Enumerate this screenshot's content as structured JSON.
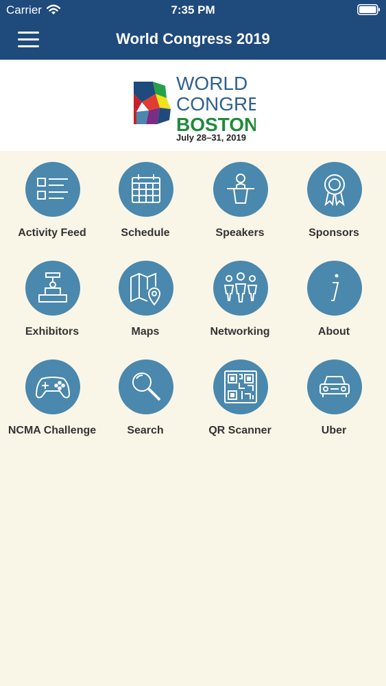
{
  "status_bar": {
    "carrier": "Carrier",
    "time": "7:35 PM"
  },
  "header": {
    "title": "World Congress 2019",
    "menu_icon": "hamburger-menu-icon"
  },
  "banner": {
    "logo_line1": "WORLD",
    "logo_line2": "CONGRESS",
    "logo_line3": "BOSTON",
    "dates": "July 28–31, 2019"
  },
  "tiles": [
    {
      "label": "Activity Feed",
      "icon": "activity-feed-icon"
    },
    {
      "label": "Schedule",
      "icon": "calendar-icon"
    },
    {
      "label": "Speakers",
      "icon": "speaker-podium-icon"
    },
    {
      "label": "Sponsors",
      "icon": "award-ribbon-icon"
    },
    {
      "label": "Exhibitors",
      "icon": "exhibitor-booth-icon"
    },
    {
      "label": "Maps",
      "icon": "map-pin-icon"
    },
    {
      "label": "Networking",
      "icon": "people-group-icon"
    },
    {
      "label": "About",
      "icon": "info-icon"
    },
    {
      "label": "NCMA Challenge",
      "icon": "gamepad-icon"
    },
    {
      "label": "Search",
      "icon": "magnifier-icon"
    },
    {
      "label": "QR Scanner",
      "icon": "qr-code-icon"
    },
    {
      "label": "Uber",
      "icon": "car-icon"
    }
  ],
  "colors": {
    "header": "#1f4a7c",
    "tile_circle": "#4a88ad",
    "background": "#f9f6e8"
  }
}
